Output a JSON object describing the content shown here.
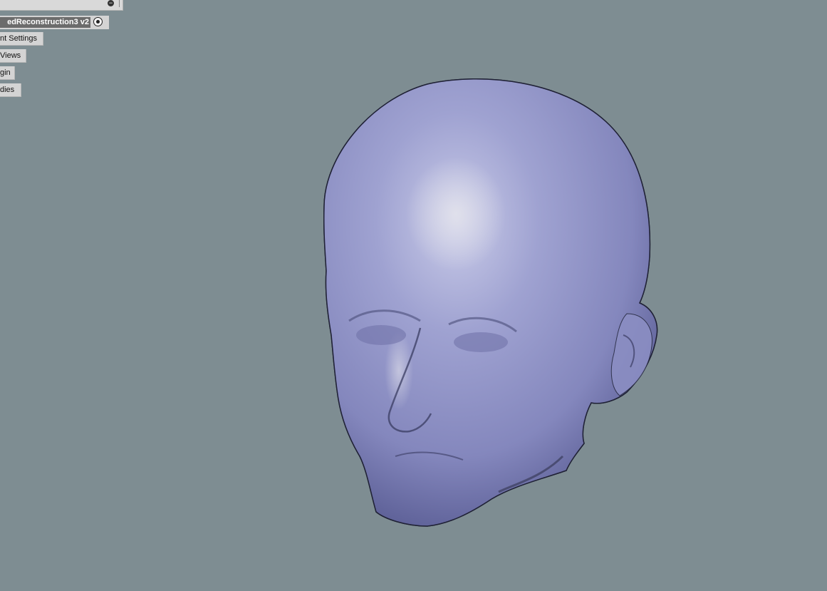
{
  "browser": {
    "collapse_label": "−",
    "component": {
      "name": "edReconstruction3 v2"
    },
    "folders": [
      {
        "label": "nt Settings"
      },
      {
        "label": "Views"
      },
      {
        "label": "gin"
      },
      {
        "label": "dies"
      }
    ]
  },
  "viewport": {
    "background_color": "#7e8d92",
    "model_color": "#9a9cca",
    "mesh_line_color": "#2a2d45",
    "model": "head-mesh"
  }
}
